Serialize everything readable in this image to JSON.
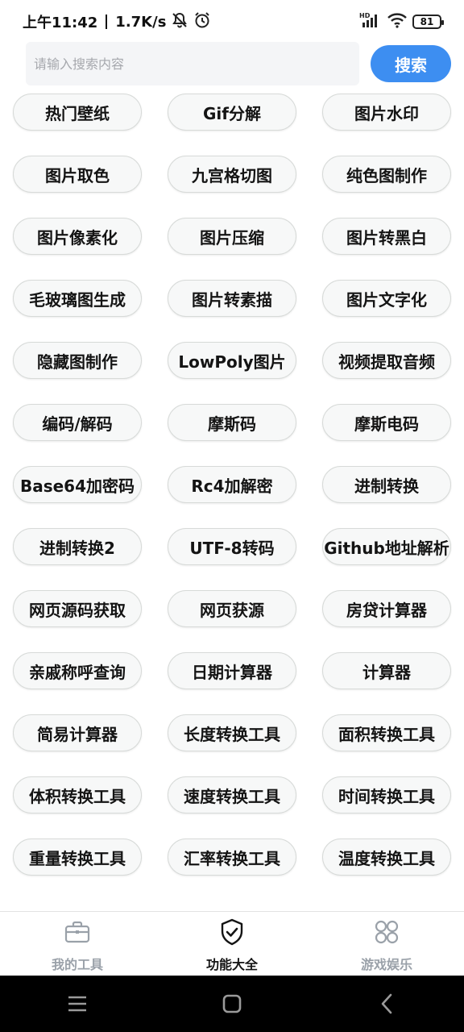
{
  "status_bar": {
    "time": "上午11:42",
    "speed": "1.7K/s",
    "battery": "81",
    "hd": "HD"
  },
  "search": {
    "placeholder": "请输入搜索内容",
    "button_label": "搜索",
    "accent_color": "#3d8ef1"
  },
  "tools": [
    "热门壁纸",
    "Gif分解",
    "图片水印",
    "图片取色",
    "九宫格切图",
    "纯色图制作",
    "图片像素化",
    "图片压缩",
    "图片转黑白",
    "毛玻璃图生成",
    "图片转素描",
    "图片文字化",
    "隐藏图制作",
    "LowPoly图片",
    "视频提取音频",
    "编码/解码",
    "摩斯码",
    "摩斯电码",
    "Base64加密码",
    "Rc4加解密",
    "进制转换",
    "进制转换2",
    "UTF-8转码",
    "Github地址解析",
    "网页源码获取",
    "网页获源",
    "房贷计算器",
    "亲戚称呼查询",
    "日期计算器",
    "计算器",
    "简易计算器",
    "长度转换工具",
    "面积转换工具",
    "体积转换工具",
    "速度转换工具",
    "时间转换工具",
    "重量转换工具",
    "汇率转换工具",
    "温度转换工具"
  ],
  "bottom_nav": {
    "items": [
      {
        "label": "我的工具",
        "icon": "briefcase-icon",
        "active": false
      },
      {
        "label": "功能大全",
        "icon": "shield-check-icon",
        "active": true
      },
      {
        "label": "游戏娱乐",
        "icon": "clover-icon",
        "active": false
      }
    ]
  },
  "system_nav": {
    "icons": [
      "menu-icon",
      "home-icon",
      "back-icon"
    ]
  }
}
